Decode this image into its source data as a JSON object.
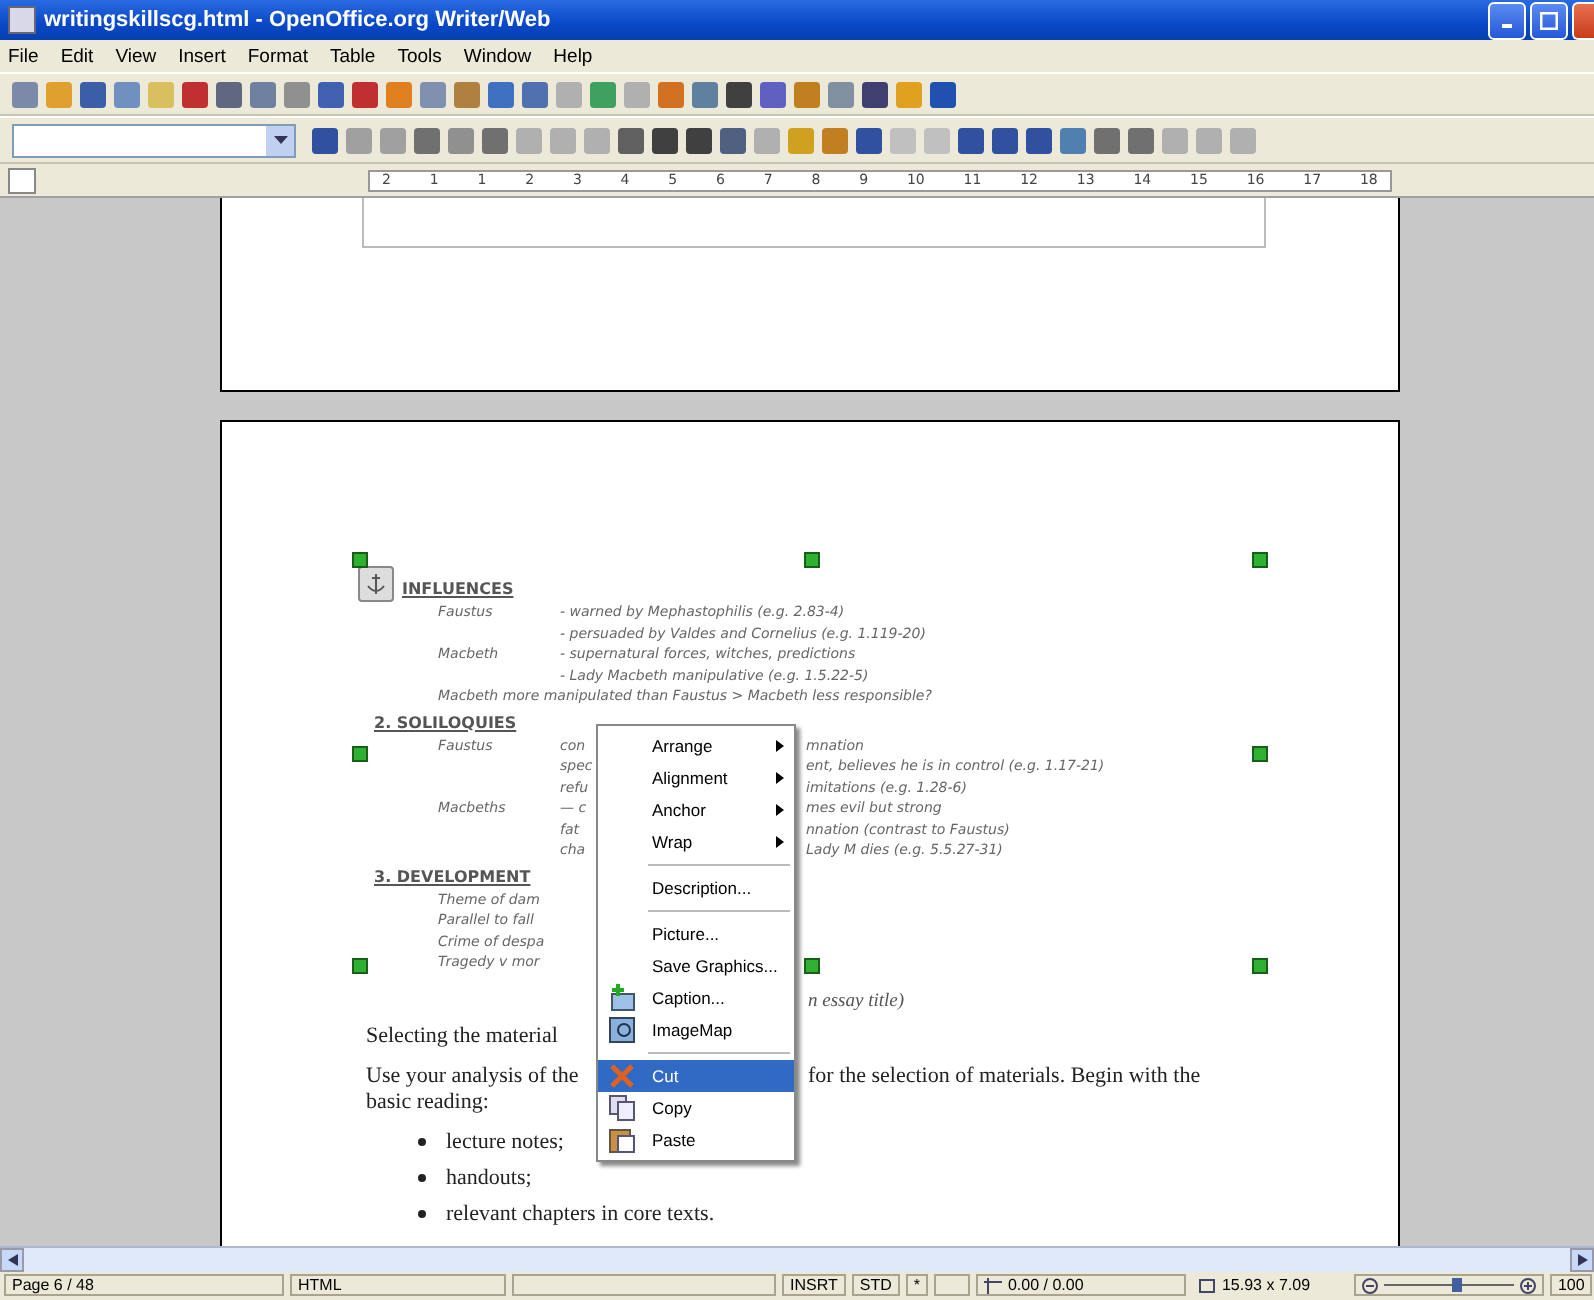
{
  "window": {
    "title": "writingskillscg.html - OpenOffice.org Writer/Web"
  },
  "menu_bar": [
    "File",
    "Edit",
    "View",
    "Insert",
    "Format",
    "Table",
    "Tools",
    "Window",
    "Help"
  ],
  "ruler": {
    "labels": [
      "2",
      "1",
      "1",
      "2",
      "3",
      "4",
      "5",
      "6",
      "7",
      "8",
      "9",
      "10",
      "11",
      "12",
      "13",
      "14",
      "15",
      "16",
      "17",
      "18"
    ]
  },
  "document": {
    "image": {
      "sections": [
        {
          "heading": "INFLUENCES",
          "rows": [
            {
              "kind": "entry",
              "label": "Faustus",
              "text": "- warned by Mephastophilis (e.g. 2.83-4)"
            },
            {
              "kind": "entry",
              "label": "",
              "text": "- persuaded by Valdes and Cornelius (e.g. 1.119-20)"
            },
            {
              "kind": "entry",
              "label": "Macbeth",
              "text": "- supernatural forces, witches, predictions"
            },
            {
              "kind": "entry",
              "label": "",
              "text": "- Lady Macbeth manipulative (e.g. 1.5.22-5)"
            },
            {
              "kind": "line",
              "text": "Macbeth more manipulated than Faustus > Macbeth less responsible?"
            }
          ]
        },
        {
          "heading": "2. SOLILOQUIES",
          "rows": [
            {
              "kind": "split",
              "label": "Faustus",
              "left": "con",
              "right": "mnation"
            },
            {
              "kind": "split",
              "label": "",
              "left": "spec",
              "right": "ent, believes he is in control (e.g. 1.17-21)"
            },
            {
              "kind": "split",
              "label": "",
              "left": "refu",
              "right": "imitations (e.g. 1.28-6)"
            },
            {
              "kind": "split",
              "label": "Macbeths",
              "left": "— c",
              "right": "mes evil but strong"
            },
            {
              "kind": "split",
              "label": "",
              "left": "fat",
              "right": "nnation (contrast to Faustus)"
            },
            {
              "kind": "split",
              "label": "",
              "left": "cha",
              "right": "Lady M dies (e.g. 5.5.27-31)"
            }
          ]
        },
        {
          "heading": "3. DEVELOPMENT",
          "rows": [
            {
              "kind": "line",
              "text": "Theme of dam"
            },
            {
              "kind": "line",
              "text": "Parallel to fall"
            },
            {
              "kind": "line",
              "text": "Crime of despa"
            },
            {
              "kind": "line",
              "text": "Tragedy v mor"
            }
          ]
        }
      ]
    },
    "body": [
      {
        "kind": "caption",
        "text": "n essay title)"
      },
      {
        "kind": "para",
        "text": "Selecting the material"
      },
      {
        "kind": "split",
        "left": "Use your analysis of the",
        "right": "for the selection of materials. Begin with the"
      },
      {
        "kind": "para",
        "text": "basic reading:"
      },
      {
        "kind": "bullet",
        "text": "lecture notes;"
      },
      {
        "kind": "bullet",
        "text": "handouts;"
      },
      {
        "kind": "bullet",
        "text": "relevant chapters in core texts."
      }
    ]
  },
  "context_menu": {
    "items": [
      {
        "kind": "submenu",
        "label": "Arrange",
        "selected": false
      },
      {
        "kind": "submenu",
        "label": "Alignment",
        "selected": false
      },
      {
        "kind": "submenu",
        "label": "Anchor",
        "selected": false
      },
      {
        "kind": "submenu",
        "label": "Wrap",
        "selected": false
      },
      {
        "kind": "separator"
      },
      {
        "kind": "item",
        "label": "Description...",
        "selected": false
      },
      {
        "kind": "separator"
      },
      {
        "kind": "item",
        "label": "Picture...",
        "selected": false
      },
      {
        "kind": "item",
        "label": "Save Graphics...",
        "selected": false
      },
      {
        "kind": "item",
        "label": "Caption...",
        "selected": false
      },
      {
        "kind": "item",
        "label": "ImageMap",
        "selected": false
      },
      {
        "kind": "separator"
      },
      {
        "kind": "item",
        "label": "Cut",
        "selected": true
      },
      {
        "kind": "item",
        "label": "Copy",
        "selected": false
      },
      {
        "kind": "item",
        "label": "Paste",
        "selected": false
      }
    ]
  },
  "status_bar": {
    "page": "Page 6 / 48",
    "mode": "HTML",
    "insert": "INSRT",
    "selection_mode": "STD",
    "modified": "*",
    "position": "0.00 / 0.00",
    "size": "15.93 x 7.09",
    "zoom_slider": {
      "level": 0.55
    },
    "zoom": "100"
  }
}
